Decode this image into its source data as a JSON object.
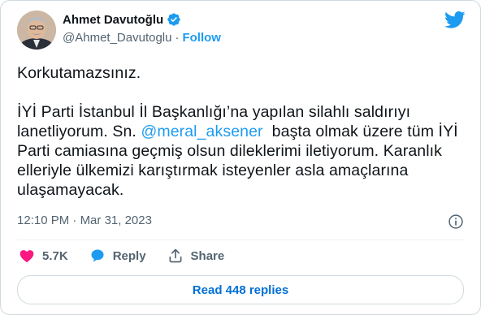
{
  "author": {
    "name": "Ahmet Davutoğlu",
    "handle": "@Ahmet_Davutoglu",
    "separator": "·",
    "follow_label": "Follow"
  },
  "tweet": {
    "line1": "Korkutamazsınız.",
    "line2_before": "İYİ Parti İstanbul İl Başkanlığı’na yapılan silahlı saldırıyı lanetliyorum. Sn. ",
    "mention": "@meral_aksener",
    "line2_after": "  başta olmak üzere tüm İYİ Parti camiasına geçmiş olsun dileklerimi iletiyorum. Karanlık elleriyle ülkemizi karıştırmak isteyenler asla amaçlarına ulaşamayacak."
  },
  "meta": {
    "time": "12:10 PM",
    "separator": "·",
    "date": "Mar 31, 2023"
  },
  "actions": {
    "likes": "5.7K",
    "reply_label": "Reply",
    "share_label": "Share"
  },
  "replies_button": "Read 448 replies",
  "colors": {
    "accent": "#1d9bf0",
    "like": "#f91880",
    "text": "#0f1419",
    "muted": "#536471"
  },
  "icons": [
    "verified-badge-icon",
    "twitter-bird-icon",
    "info-icon",
    "heart-icon",
    "reply-bubble-icon",
    "share-icon"
  ]
}
